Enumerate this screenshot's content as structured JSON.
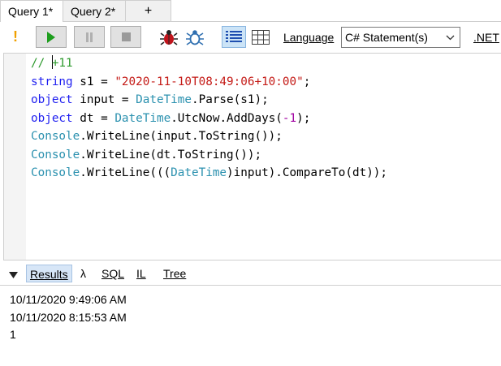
{
  "tabs": [
    {
      "label": "Query 1*",
      "active": true
    },
    {
      "label": "Query 2*",
      "active": false
    }
  ],
  "add_tab_label": "+",
  "toolbar": {
    "warning_glyph": "!",
    "language_label": "Language",
    "language_value": "C# Statement(s)",
    "net_label": ".NET",
    "icons": [
      "run-icon",
      "pause-icon",
      "stop-icon",
      "bug-icon",
      "bug-active-icon",
      "rich-text-results-icon",
      "data-grid-results-icon"
    ]
  },
  "editor": {
    "lines": [
      [
        {
          "t": "// ",
          "c": "cm"
        },
        {
          "t": "caret"
        },
        {
          "t": "+11",
          "c": "cm"
        }
      ],
      [
        {
          "t": "string",
          "c": "kw"
        },
        {
          "t": " s1 = "
        },
        {
          "t": "\"2020-11-10T08:49:06+10:00\"",
          "c": "str"
        },
        {
          "t": ";"
        }
      ],
      [
        {
          "t": "object",
          "c": "kw"
        },
        {
          "t": " input = "
        },
        {
          "t": "DateTime",
          "c": "ty"
        },
        {
          "t": ".Parse(s1);"
        }
      ],
      [
        {
          "t": "object",
          "c": "kw"
        },
        {
          "t": " dt = "
        },
        {
          "t": "DateTime",
          "c": "ty"
        },
        {
          "t": ".UtcNow.AddDays("
        },
        {
          "t": "-1",
          "c": "num"
        },
        {
          "t": ");"
        }
      ],
      [
        {
          "t": "Console",
          "c": "ty"
        },
        {
          "t": ".WriteLine(input.ToString());"
        }
      ],
      [
        {
          "t": "Console",
          "c": "ty"
        },
        {
          "t": ".WriteLine(dt.ToString());"
        }
      ],
      [
        {
          "t": "Console",
          "c": "ty"
        },
        {
          "t": ".WriteLine((("
        },
        {
          "t": "DateTime",
          "c": "ty"
        },
        {
          "t": ")input).CompareTo(dt));"
        }
      ]
    ]
  },
  "results_tabs": [
    {
      "label": "Results",
      "active": true
    },
    {
      "label": "λ",
      "active": false
    },
    {
      "label": "SQL",
      "active": false
    },
    {
      "label": "IL",
      "active": false
    },
    {
      "label": "Tree",
      "active": false
    }
  ],
  "output": [
    "10/11/2020 9:49:06 AM",
    "10/11/2020 8:15:53 AM",
    "1"
  ],
  "colors": {
    "accent": "#cce4f7",
    "comment": "#2e9a2e",
    "keyword": "#1f1ff0",
    "string": "#c41a16",
    "type": "#2b91af",
    "number": "#a000a0",
    "run_green": "#1e9e1e",
    "bug_red": "#c0141c",
    "bug_blue": "#2f6fb0"
  }
}
